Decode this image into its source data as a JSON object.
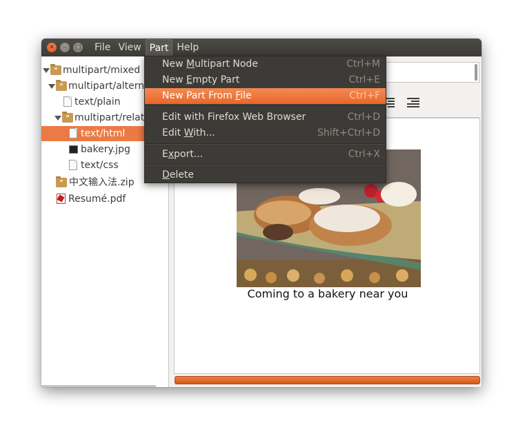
{
  "window": {
    "menus": [
      "File",
      "View",
      "Part",
      "Help"
    ]
  },
  "tree": [
    {
      "label": "multipart/mixed",
      "icon": "folder-icon",
      "depth": 0,
      "expanded": true
    },
    {
      "label": "multipart/altern",
      "icon": "folder-icon",
      "depth": 1,
      "expanded": true
    },
    {
      "label": "text/plain",
      "icon": "text-file-icon",
      "depth": 2
    },
    {
      "label": "multipart/relat",
      "icon": "folder-icon",
      "depth": 2,
      "expanded": true
    },
    {
      "label": "text/html",
      "icon": "html-file-icon",
      "depth": 3,
      "selected": true
    },
    {
      "label": "bakery.jpg",
      "icon": "image-file-icon",
      "depth": 3
    },
    {
      "label": "text/css",
      "icon": "text-file-icon",
      "depth": 3
    },
    {
      "label": "中文输入法.zip",
      "icon": "folder-icon",
      "depth": 1
    },
    {
      "label": "Resumé.pdf",
      "icon": "pdf-file-icon",
      "depth": 1
    }
  ],
  "part_menu": [
    {
      "label": "New Multipart Node",
      "mnemonic_index": 4,
      "accel": "Ctrl+M"
    },
    {
      "label": "New Empty Part",
      "mnemonic_index": 4,
      "accel": "Ctrl+E"
    },
    {
      "label": "New Part From File",
      "mnemonic_index": 14,
      "accel": "Ctrl+F",
      "highlighted": true
    },
    {
      "label": "Edit with Firefox Web Browser",
      "accel": "Ctrl+D"
    },
    {
      "label": "Edit With...",
      "mnemonic_index": 5,
      "accel": "Shift+Ctrl+D"
    },
    {
      "label": "Export...",
      "mnemonic_index": 1,
      "accel": "Ctrl+X"
    },
    {
      "label": "Delete",
      "mnemonic_index": 0,
      "accel": ""
    }
  ],
  "preview": {
    "caption": "Coming to a bakery near you"
  },
  "colors": {
    "accent": "#ec7a45",
    "titlebar": "#3c3b37",
    "menu_bg": "#3c3b37"
  }
}
